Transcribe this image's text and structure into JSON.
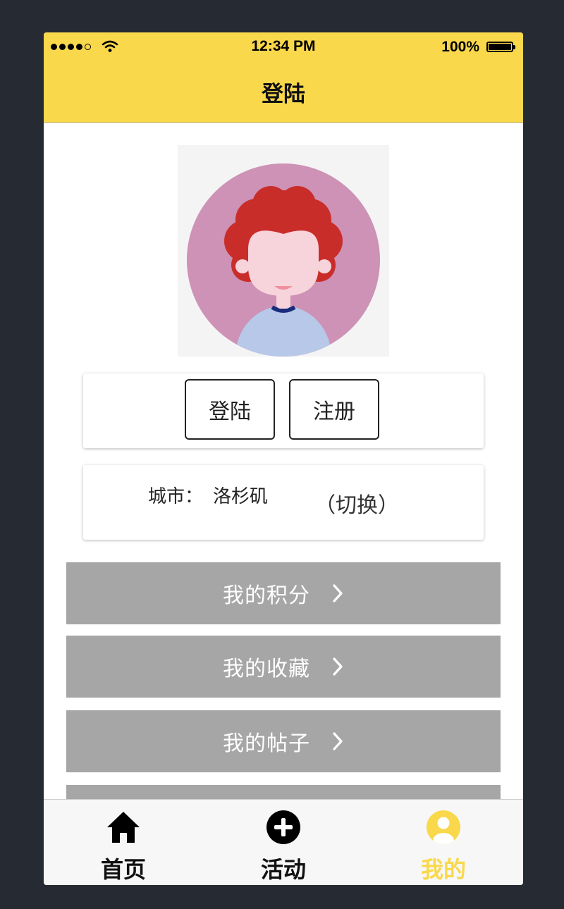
{
  "status_bar": {
    "time": "12:34 PM",
    "battery": "100%",
    "signal_bars_filled": 4,
    "signal_bars_total": 5
  },
  "header": {
    "title": "登陆"
  },
  "auth": {
    "login_label": "登陆",
    "register_label": "注册"
  },
  "city": {
    "label": "城市：",
    "name": "洛杉矶",
    "switch_label": "（切换）"
  },
  "menu": {
    "items": [
      {
        "label": "我的积分"
      },
      {
        "label": "我的收藏"
      },
      {
        "label": "我的帖子"
      },
      {
        "label": ""
      }
    ]
  },
  "tabbar": {
    "items": [
      {
        "label": "首页",
        "icon": "home-icon",
        "active": false
      },
      {
        "label": "活动",
        "icon": "add-circle-icon",
        "active": false
      },
      {
        "label": "我的",
        "icon": "user-circle-icon",
        "active": true
      }
    ]
  },
  "colors": {
    "brand_yellow": "#f9d84b",
    "menu_gray": "#a6a6a6",
    "backdrop": "#252a33"
  }
}
